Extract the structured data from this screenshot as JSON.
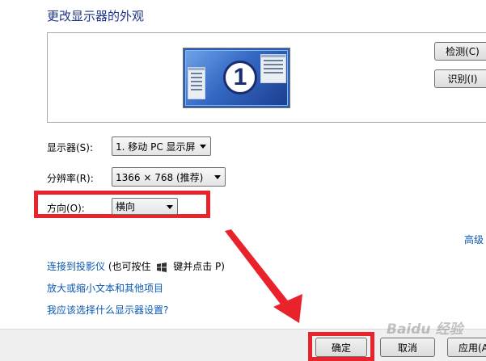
{
  "header": {
    "title": "更改显示器的外观"
  },
  "preview": {
    "monitor_number": "1",
    "detect_label": "检测(C)",
    "identify_label": "识别(I)"
  },
  "settings": {
    "display_label": "显示器(S):",
    "display_value": "1. 移动 PC 显示屏",
    "resolution_label": "分辨率(R):",
    "resolution_value": "1366 × 768 (推荐)",
    "orientation_label": "方向(O):",
    "orientation_value": "横向",
    "advanced_label": "高级"
  },
  "links": {
    "projector_link": "连接到投影仪",
    "projector_hint_prefix": "(也可按住",
    "projector_hint_suffix": "键并点击 P)",
    "enlarge_link": "放大或缩小文本和其他项目",
    "which_settings_link": "我应该选择什么显示器设置?"
  },
  "footer": {
    "ok_label": "确定",
    "cancel_label": "取消",
    "apply_label": "应用(A"
  },
  "watermark": "Baidu 经验",
  "icons": [
    "monitor-icon",
    "windows-logo-icon",
    "dropdown-arrow-icon",
    "red-arrow-annotation"
  ],
  "colors": {
    "link": "#0b58b0",
    "title": "#1e3287",
    "annotation": "#e8232b"
  }
}
